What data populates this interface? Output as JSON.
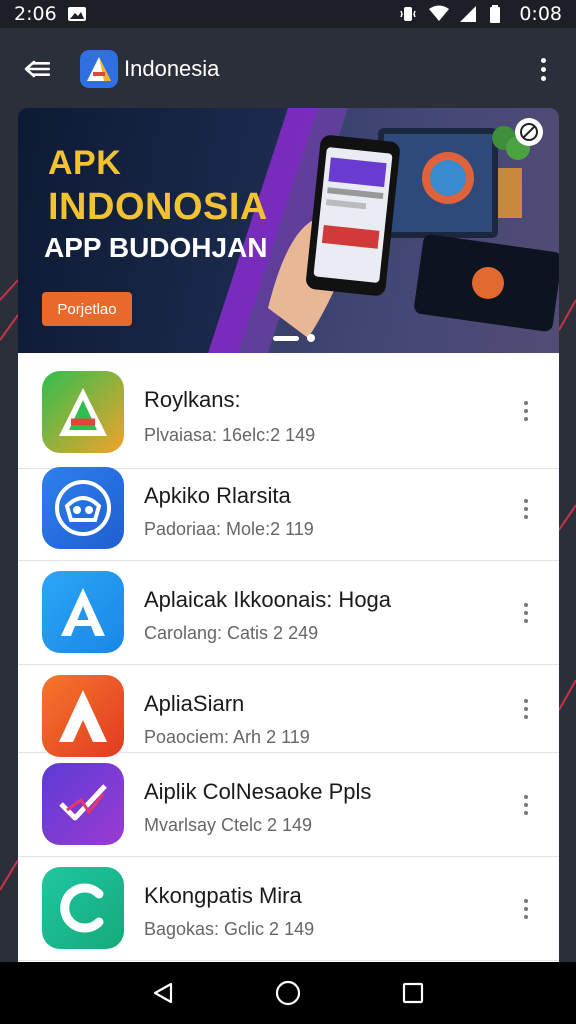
{
  "status_bar": {
    "time_left": "2:06",
    "time_right": "0:08"
  },
  "app_bar": {
    "title": "Indonesia",
    "icons": [
      "menu-icon",
      "app-logo-icon",
      "more-vert-icon"
    ]
  },
  "banner": {
    "line1": "APK",
    "line2": "INDONOSIA",
    "line3": "APP BUDOHJAN",
    "cta": "Porjetlao",
    "carousel": {
      "count": 2,
      "active": 0
    }
  },
  "apps": [
    {
      "name": "Roylkans:",
      "meta": "Plvaiasa: 16elc:2 149",
      "icon": "green-orange-a-icon",
      "colors": [
        "#2fbf4f",
        "#f2a22b"
      ]
    },
    {
      "name": "Apkiko Rlarsita",
      "meta": "Padoriaa: Mole:2 119",
      "icon": "blue-circle-logo-icon",
      "colors": [
        "#2d7ff0",
        "#1f5fd0"
      ]
    },
    {
      "name": "Aplaicak Ikkoonais: Hoga",
      "meta": "Carolang: Catis 2 249",
      "icon": "blue-a-icon",
      "colors": [
        "#2aa7f5",
        "#1b86e6"
      ]
    },
    {
      "name": "ApliaSiarn",
      "meta": "Poaociem: Arh 2 119",
      "icon": "orange-red-a-icon",
      "colors": [
        "#f5772a",
        "#e23a22"
      ]
    },
    {
      "name": "Aiplik ColNesaoke Ppls",
      "meta": "Mvarlsay Ctelc 2 149",
      "icon": "purple-check-icon",
      "colors": [
        "#5b3bd6",
        "#9b3bd0"
      ]
    },
    {
      "name": "Kkongpatis Mira",
      "meta": "Bagokas: Gclic 2 149",
      "icon": "green-c-icon",
      "colors": [
        "#1ec7a0",
        "#16a97a"
      ]
    }
  ],
  "nav": {
    "icons": [
      "back-icon",
      "home-icon",
      "recents-icon"
    ]
  }
}
